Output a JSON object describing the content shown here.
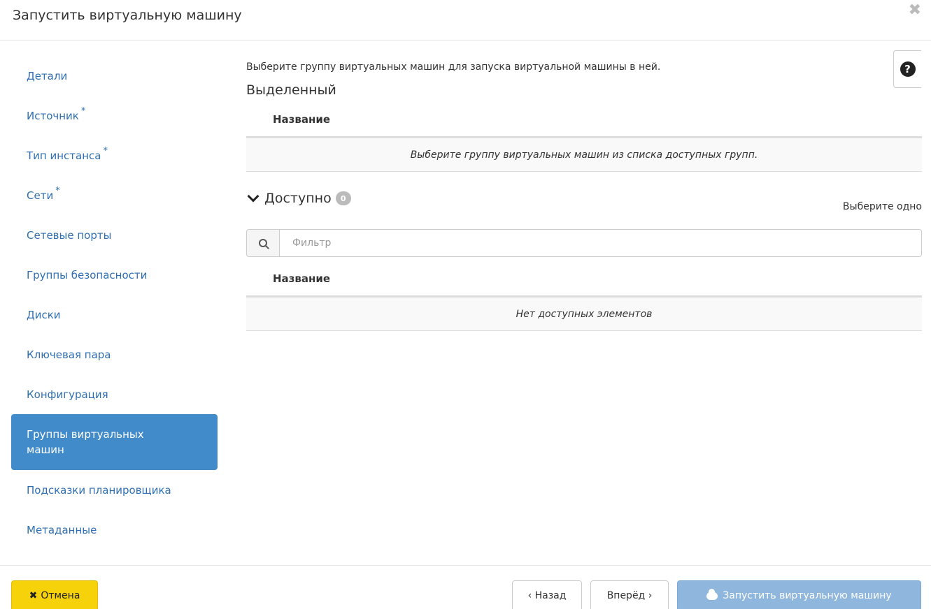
{
  "modal": {
    "title": "Запустить виртуальную машину",
    "close_glyph": "✖"
  },
  "sidebar": {
    "items": [
      {
        "label": "Детали",
        "required": false
      },
      {
        "label": "Источник",
        "required": true
      },
      {
        "label": "Тип инстанса",
        "required": true
      },
      {
        "label": "Сети",
        "required": true
      },
      {
        "label": "Сетевые порты",
        "required": false
      },
      {
        "label": "Группы безопасности",
        "required": false
      },
      {
        "label": "Диски",
        "required": false
      },
      {
        "label": "Ключевая пара",
        "required": false
      },
      {
        "label": "Конфигурация",
        "required": false
      },
      {
        "label": "Группы виртуальных машин",
        "required": false,
        "active": true
      },
      {
        "label": "Подсказки планировщика",
        "required": false
      },
      {
        "label": "Метаданные",
        "required": false
      }
    ],
    "required_marker": "*"
  },
  "content": {
    "description": "Выберите группу виртуальных машин для запуска виртуальной машины в ней.",
    "selected": {
      "title": "Выделенный",
      "column_header": "Название",
      "empty_text": "Выберите группу виртуальных машин из списка доступных групп."
    },
    "available": {
      "title": "Доступно",
      "count": "0",
      "select_hint": "Выберите одно",
      "filter_placeholder": "Фильтр",
      "column_header": "Название",
      "empty_text": "Нет доступных элементов"
    },
    "help_glyph": "?"
  },
  "footer": {
    "cancel_label": "Отмена",
    "cancel_glyph": "✖",
    "back_label": "‹ Назад",
    "next_label": "Вперёд ›",
    "launch_label": "Запустить виртуальную машину"
  },
  "colors": {
    "accent": "#428bca",
    "link": "#2f6fb1",
    "cancel": "#f5d20a",
    "launch_disabled": "#8fb6dc"
  }
}
